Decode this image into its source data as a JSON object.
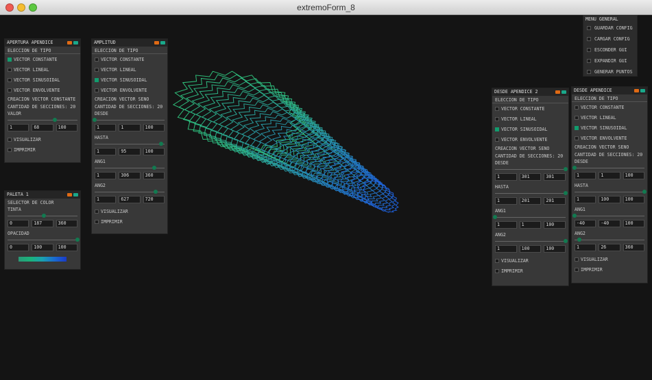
{
  "window": {
    "title": "extremoForm_8"
  },
  "menu": {
    "title": "MENU GENERAL",
    "items": [
      "GUARDAR CONFIG",
      "CARGAR CONFIG",
      "ESCONDER GUI",
      "EXPANDIR GUI",
      "GENERAR PUNTOS"
    ]
  },
  "colors": {
    "accent": "#129c6e",
    "minimize": "#e06a14",
    "expand": "#1aa88a",
    "background": "#141414",
    "panel": "#383838",
    "shape_top": "#2fbf7a",
    "shape_bottom": "#1e5fd8"
  },
  "icons": {
    "minimize": "orange-minimize-icon",
    "expand": "teal-expand-icon"
  },
  "panels": {
    "apertura": {
      "title": "APERTURA APENDICE",
      "tipo_label": "ELECCION DE TIPO",
      "options": [
        {
          "label": "VECTOR CONSTANTE",
          "checked": true
        },
        {
          "label": "VECTOR LINEAL",
          "checked": false
        },
        {
          "label": "VECTOR SINUSOIDAL",
          "checked": false
        },
        {
          "label": "VECTOR ENVOLVENTE",
          "checked": false
        }
      ],
      "creacion": "CREACION VECTOR CONSTANTE",
      "secciones": "CANTIDAD DE SECCIONES: 20",
      "params": [
        {
          "label": "VALOR",
          "min": "1",
          "value": "68",
          "max": "100",
          "level": 0.68
        }
      ],
      "visualizar": "VISUALIZAR",
      "imprimir": "IMPRIMIR"
    },
    "amplitud": {
      "title": "AMPLITUD",
      "tipo_label": "ELECCION DE TIPO",
      "options": [
        {
          "label": "VECTOR CONSTANTE",
          "checked": false
        },
        {
          "label": "VECTOR LINEAL",
          "checked": false
        },
        {
          "label": "VECTOR SINUSOIDAL",
          "checked": true
        },
        {
          "label": "VECTOR ENVOLVENTE",
          "checked": false
        }
      ],
      "creacion": "CREACION VECTOR SENO",
      "secciones": "CANTIDAD DE SECCIONES: 20",
      "params": [
        {
          "label": "DESDE",
          "min": "1",
          "value": "1",
          "max": "100",
          "level": 0.0
        },
        {
          "label": "HASTA",
          "min": "1",
          "value": "95",
          "max": "100",
          "level": 0.95
        },
        {
          "label": "ANG1",
          "min": "1",
          "value": "306",
          "max": "360",
          "level": 0.85
        },
        {
          "label": "ANG2",
          "min": "1",
          "value": "627",
          "max": "720",
          "level": 0.87
        }
      ],
      "visualizar": "VISUALIZAR",
      "imprimir": "IMPRIMIR"
    },
    "paleta": {
      "title": "PALETA 1",
      "selector": "SELECTOR DE COLOR",
      "params": [
        {
          "label": "TINTA",
          "min": "0",
          "value": "187",
          "max": "360",
          "level": 0.52
        },
        {
          "label": "OPACIDAD",
          "min": "0",
          "value": "100",
          "max": "100",
          "level": 1.0
        }
      ]
    },
    "desde2": {
      "title": "DESDE APENDICE 2",
      "tipo_label": "ELECCION DE TIPO",
      "options": [
        {
          "label": "VECTOR CONSTANTE",
          "checked": false
        },
        {
          "label": "VECTOR LINEAL",
          "checked": false
        },
        {
          "label": "VECTOR SINUSOIDAL",
          "checked": true
        },
        {
          "label": "VECTOR ENVOLVENTE",
          "checked": false
        }
      ],
      "creacion": "CREACION VECTOR SENO",
      "secciones": "CANTIDAD DE SECCIONES: 20",
      "params": [
        {
          "label": "DESDE",
          "min": "1",
          "value": "301",
          "max": "301",
          "level": 1.0
        },
        {
          "label": "HASTA",
          "min": "1",
          "value": "201",
          "max": "201",
          "level": 1.0
        },
        {
          "label": "ANG1",
          "min": "1",
          "value": "1",
          "max": "100",
          "level": 0.0
        },
        {
          "label": "ANG2",
          "min": "1",
          "value": "100",
          "max": "100",
          "level": 1.0
        }
      ],
      "visualizar": "VISUALIZAR",
      "imprimir": "IMPRIMIR"
    },
    "desde": {
      "title": "DESDE APENDICE",
      "tipo_label": "ELECCION DE TIPO",
      "options": [
        {
          "label": "VECTOR CONSTANTE",
          "checked": false
        },
        {
          "label": "VECTOR LINEAL",
          "checked": false
        },
        {
          "label": "VECTOR SINUSOIDAL",
          "checked": true
        },
        {
          "label": "VECTOR ENVOLVENTE",
          "checked": false
        }
      ],
      "creacion": "CREACION VECTOR SENO",
      "secciones": "CANTIDAD DE SECCIONES: 20",
      "params": [
        {
          "label": "DESDE",
          "min": "1",
          "value": "1",
          "max": "100",
          "level": 0.0
        },
        {
          "label": "HASTA",
          "min": "1",
          "value": "100",
          "max": "100",
          "level": 1.0
        },
        {
          "label": "ANG1",
          "min": "-40",
          "value": "-40",
          "max": "100",
          "level": 0.0
        },
        {
          "label": "ANG2",
          "min": "1",
          "value": "26",
          "max": "360",
          "level": 0.07
        }
      ],
      "visualizar": "VISUALIZAR",
      "imprimir": "IMPRIMIR"
    }
  }
}
